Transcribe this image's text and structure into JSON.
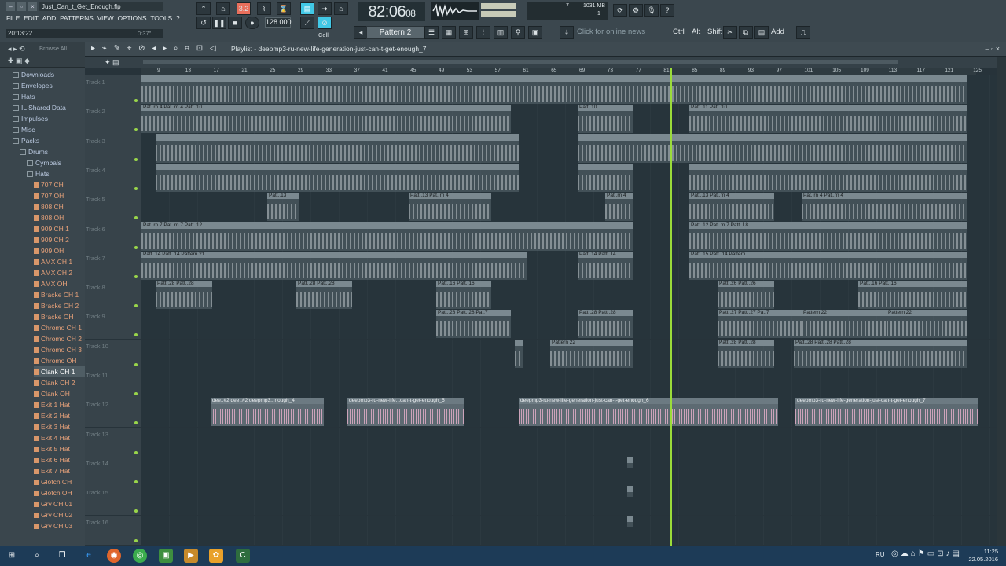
{
  "window": {
    "title": "Just_Can_t_Get_Enough.flp"
  },
  "menu": [
    "FILE",
    "EDIT",
    "ADD",
    "PATTERNS",
    "VIEW",
    "OPTIONS",
    "TOOLS",
    "?"
  ],
  "hint": {
    "time": "20:13:22",
    "right": "0:37\""
  },
  "transport": {
    "time": "82:06",
    "time_small": "08",
    "tempo": "128.000",
    "pattern_label": "3.2",
    "cpu": "1031 MB",
    "cpu2": "7",
    "cpu3": "1"
  },
  "toolbar": {
    "pattern": "Pattern 2",
    "news": "Click for online news",
    "ctrl": "Ctrl",
    "alt": "Alt",
    "shift": "Shift",
    "add": "Add",
    "cell": "Cell"
  },
  "browser": {
    "label": "Browse All",
    "items": [
      {
        "t": "Downloads",
        "k": "folder",
        "i": 0
      },
      {
        "t": "Envelopes",
        "k": "folder",
        "i": 0
      },
      {
        "t": "Hats",
        "k": "folder",
        "i": 0
      },
      {
        "t": "IL Shared Data",
        "k": "folder",
        "i": 0
      },
      {
        "t": "Impulses",
        "k": "folder",
        "i": 0
      },
      {
        "t": "Misc",
        "k": "folder",
        "i": 0
      },
      {
        "t": "Packs",
        "k": "folder",
        "i": 0
      },
      {
        "t": "Drums",
        "k": "folder",
        "i": 1
      },
      {
        "t": "Cymbals",
        "k": "folder",
        "i": 2
      },
      {
        "t": "Hats",
        "k": "folder",
        "i": 2
      },
      {
        "t": "707 CH",
        "k": "file",
        "i": 3
      },
      {
        "t": "707 OH",
        "k": "file",
        "i": 3
      },
      {
        "t": "808 CH",
        "k": "file",
        "i": 3
      },
      {
        "t": "808 OH",
        "k": "file",
        "i": 3
      },
      {
        "t": "909 CH 1",
        "k": "file",
        "i": 3
      },
      {
        "t": "909 CH 2",
        "k": "file",
        "i": 3
      },
      {
        "t": "909 OH",
        "k": "file",
        "i": 3
      },
      {
        "t": "AMX CH 1",
        "k": "file",
        "i": 3
      },
      {
        "t": "AMX CH 2",
        "k": "file",
        "i": 3
      },
      {
        "t": "AMX OH",
        "k": "file",
        "i": 3
      },
      {
        "t": "Bracke CH 1",
        "k": "file",
        "i": 3
      },
      {
        "t": "Bracke CH 2",
        "k": "file",
        "i": 3
      },
      {
        "t": "Bracke OH",
        "k": "file",
        "i": 3
      },
      {
        "t": "Chromo CH 1",
        "k": "file",
        "i": 3
      },
      {
        "t": "Chromo CH 2",
        "k": "file",
        "i": 3
      },
      {
        "t": "Chromo CH 3",
        "k": "file",
        "i": 3
      },
      {
        "t": "Chromo OH",
        "k": "file",
        "i": 3
      },
      {
        "t": "Clank CH 1",
        "k": "file",
        "i": 3,
        "sel": true
      },
      {
        "t": "Clank CH 2",
        "k": "file",
        "i": 3
      },
      {
        "t": "Clank OH",
        "k": "file",
        "i": 3
      },
      {
        "t": "Ekit 1 Hat",
        "k": "file",
        "i": 3
      },
      {
        "t": "Ekit 2 Hat",
        "k": "file",
        "i": 3
      },
      {
        "t": "Ekit 3 Hat",
        "k": "file",
        "i": 3
      },
      {
        "t": "Ekit 4 Hat",
        "k": "file",
        "i": 3
      },
      {
        "t": "Ekit 5 Hat",
        "k": "file",
        "i": 3
      },
      {
        "t": "Ekit 6 Hat",
        "k": "file",
        "i": 3
      },
      {
        "t": "Ekit 7 Hat",
        "k": "file",
        "i": 3
      },
      {
        "t": "Glotch CH",
        "k": "file",
        "i": 3
      },
      {
        "t": "Glotch OH",
        "k": "file",
        "i": 3
      },
      {
        "t": "Grv CH 01",
        "k": "file",
        "i": 3
      },
      {
        "t": "Grv CH 02",
        "k": "file",
        "i": 3
      },
      {
        "t": "Grv CH 03",
        "k": "file",
        "i": 3
      }
    ]
  },
  "playlist": {
    "title": "Playlist - deepmp3-ru-new-life-generation-just-can-t-get-enough_7",
    "ruler": [
      "9",
      "13",
      "17",
      "21",
      "25",
      "29",
      "33",
      "37",
      "41",
      "45",
      "49",
      "53",
      "57",
      "61",
      "65",
      "69",
      "73",
      "77",
      "81",
      "85",
      "89",
      "93",
      "97",
      "101",
      "105",
      "109",
      "113",
      "117",
      "121",
      "125"
    ],
    "tracks": [
      "Track 1",
      "Track 2",
      "Track 3",
      "Track 4",
      "Track 5",
      "Track 6",
      "Track 7",
      "Track 8",
      "Track 9",
      "Track 10",
      "Track 11",
      "Track 12",
      "Track 13",
      "Track 14",
      "Track 15",
      "Track 16"
    ],
    "clips": [
      {
        "tr": 1,
        "s": 0,
        "e": 1050,
        "l": "",
        "n": 1
      },
      {
        "tr": 2,
        "s": 0,
        "e": 470,
        "l": "Pat..rn 4   Pat..rn 4   Patt..10",
        "n": 1
      },
      {
        "tr": 2,
        "s": 555,
        "e": 625,
        "l": "Patt..10",
        "n": 1
      },
      {
        "tr": 2,
        "s": 697,
        "e": 1050,
        "l": "Patt..11   Patt..10",
        "n": 1
      },
      {
        "tr": 3,
        "s": 18,
        "e": 480,
        "l": "",
        "n": 1
      },
      {
        "tr": 3,
        "s": 555,
        "e": 1050,
        "l": "",
        "n": 1
      },
      {
        "tr": 4,
        "s": 18,
        "e": 480,
        "l": "",
        "n": 1
      },
      {
        "tr": 4,
        "s": 555,
        "e": 625,
        "l": "",
        "n": 1
      },
      {
        "tr": 4,
        "s": 697,
        "e": 1050,
        "l": "",
        "n": 1
      },
      {
        "tr": 5,
        "s": 160,
        "e": 200,
        "l": "Patt..13",
        "n": 1
      },
      {
        "tr": 5,
        "s": 340,
        "e": 445,
        "l": "Patt..13   Pat..rn 4",
        "n": 1
      },
      {
        "tr": 5,
        "s": 590,
        "e": 625,
        "l": "Pat..rn 4",
        "n": 1
      },
      {
        "tr": 5,
        "s": 697,
        "e": 805,
        "l": "Patt..13   Pat..rn 4",
        "n": 1
      },
      {
        "tr": 5,
        "s": 840,
        "e": 1050,
        "l": "Pat..rn 4   Pat..rn 4",
        "n": 1
      },
      {
        "tr": 6,
        "s": 0,
        "e": 625,
        "l": "Pat..rn 7   Pat..rn 7   Patt..12",
        "n": 1
      },
      {
        "tr": 6,
        "s": 697,
        "e": 1050,
        "l": "Patt..12   Pat..rn 7   Patt..18",
        "n": 1
      },
      {
        "tr": 7,
        "s": 0,
        "e": 490,
        "l": "Patt..14   Patt..14   Pattern 21",
        "n": 1
      },
      {
        "tr": 7,
        "s": 555,
        "e": 625,
        "l": "Patt..14   Patt..14",
        "n": 1
      },
      {
        "tr": 7,
        "s": 697,
        "e": 1050,
        "l": "Patt..15   Patt..14   Pattern",
        "n": 1
      },
      {
        "tr": 8,
        "s": 18,
        "e": 90,
        "l": "Patt..28   Patt..28",
        "n": 1
      },
      {
        "tr": 8,
        "s": 197,
        "e": 268,
        "l": "Patt..28   Patt..28",
        "n": 1
      },
      {
        "tr": 8,
        "s": 375,
        "e": 445,
        "l": "Patt..16   Patt..16",
        "n": 1
      },
      {
        "tr": 8,
        "s": 733,
        "e": 805,
        "l": "Patt..26   Patt..26",
        "n": 1
      },
      {
        "tr": 8,
        "s": 912,
        "e": 1050,
        "l": "Patt..16   Patt..16",
        "n": 1
      },
      {
        "tr": 9,
        "s": 375,
        "e": 470,
        "l": "Patt..28   Patt..28   Pa..7",
        "n": 1
      },
      {
        "tr": 9,
        "s": 555,
        "e": 625,
        "l": "Patt..28   Patt..28",
        "n": 1
      },
      {
        "tr": 9,
        "s": 733,
        "e": 840,
        "l": "Patt..27   Patt..27   Pa..7",
        "n": 1
      },
      {
        "tr": 9,
        "s": 840,
        "e": 948,
        "l": "Pattern 22",
        "n": 1
      },
      {
        "tr": 9,
        "s": 948,
        "e": 1050,
        "l": "Pattern 22",
        "n": 1
      },
      {
        "tr": 10,
        "s": 475,
        "e": 485,
        "l": "",
        "n": 1
      },
      {
        "tr": 10,
        "s": 520,
        "e": 625,
        "l": "Pattern 22",
        "n": 1
      },
      {
        "tr": 10,
        "s": 733,
        "e": 805,
        "l": "Patt..28   Patt..28",
        "n": 1
      },
      {
        "tr": 10,
        "s": 830,
        "e": 1050,
        "l": "Patt..28   Patt..28   Patt..28",
        "n": 1
      }
    ],
    "audio": [
      {
        "tr": 12,
        "s": 88,
        "e": 232,
        "l": "dee..#2   dee..#2   deepmp3...nough_4"
      },
      {
        "tr": 12,
        "s": 262,
        "e": 410,
        "l": "deepmp3-ru-new-life...can-t-get-enough_5"
      },
      {
        "tr": 12,
        "s": 480,
        "e": 810,
        "l": "deepmp3-ru-new-life-generation-just-can-t-get-enough_6"
      },
      {
        "tr": 12,
        "s": 832,
        "e": 1064,
        "l": "deepmp3-ru-new-life-generation-just-can-t-get-enough_7"
      }
    ],
    "small": [
      {
        "tr": 14,
        "s": 618
      },
      {
        "tr": 15,
        "s": 618
      },
      {
        "tr": 16,
        "s": 618
      }
    ]
  },
  "taskbar": {
    "lang": "RU",
    "time": "11:25",
    "date": "22.05.2016"
  },
  "colors": {
    "accent": "#9bdc3a",
    "clip": "#7b8990",
    "wave": "#d8a9c2"
  }
}
